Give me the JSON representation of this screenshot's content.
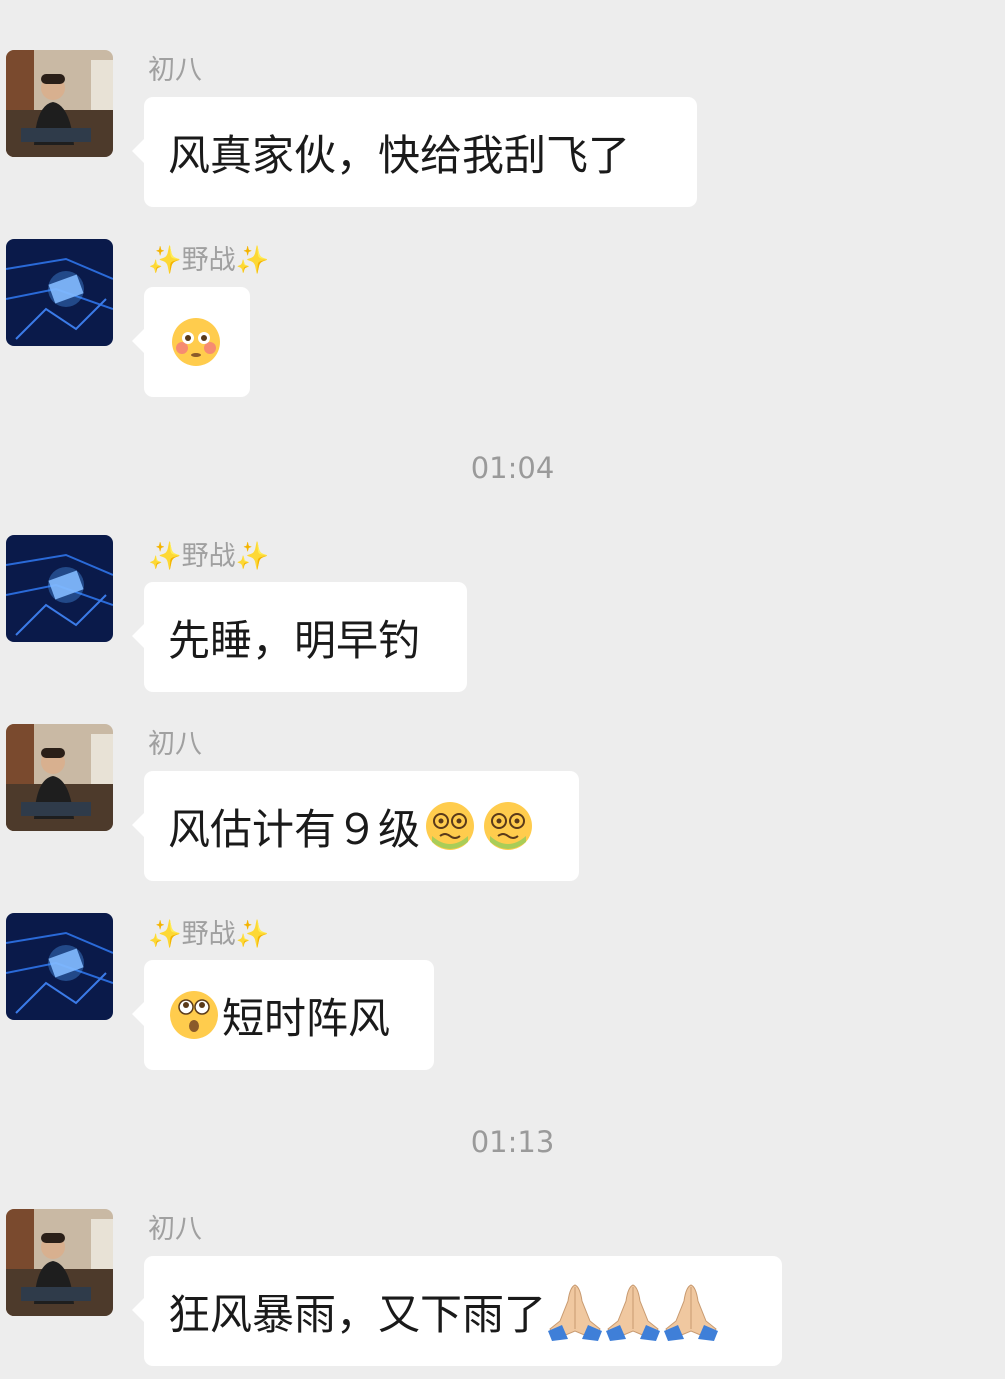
{
  "messages": [
    {
      "sender": "初八",
      "text": "风真家伙，快给我刮飞了"
    },
    {
      "sender": "✨野战✨",
      "emoji": "flushed-face-emoji"
    },
    {
      "sender": "✨野战✨",
      "text": "先睡，明早钓"
    },
    {
      "sender": "初八",
      "text": "风估计有９级",
      "trailing_emojis": [
        "woozy-face-emoji",
        "woozy-face-emoji"
      ]
    },
    {
      "sender": "✨野战✨",
      "leading_emoji": "hushed-face-emoji",
      "text": "短时阵风"
    },
    {
      "sender": "初八",
      "text": "狂风暴雨，又下雨了",
      "trailing_emojis": [
        "folded-hands-emoji",
        "folded-hands-emoji",
        "folded-hands-emoji"
      ]
    }
  ],
  "timestamps": [
    "01:04",
    "01:13"
  ],
  "colors": {
    "background": "#ededed",
    "bubble": "#ffffff",
    "sender_name": "#a0a0a0",
    "timestamp": "#9a9a9a"
  }
}
